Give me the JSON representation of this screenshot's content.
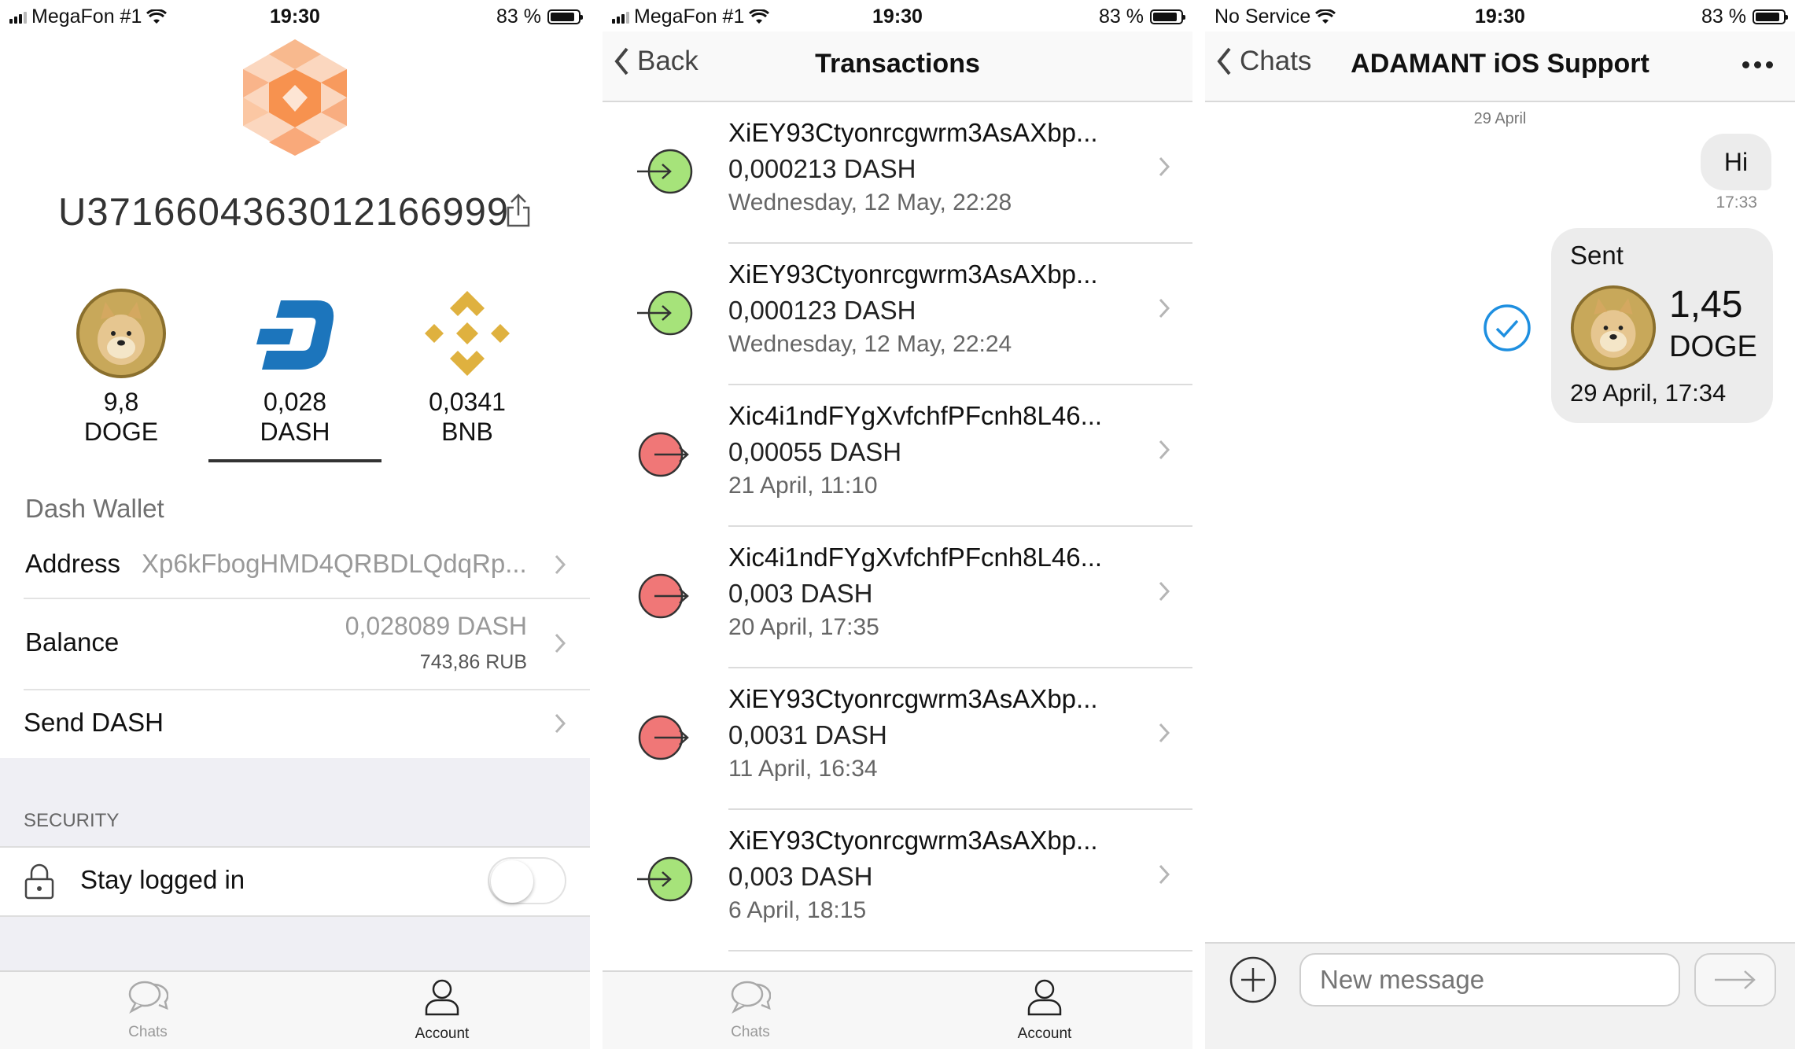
{
  "screens": [
    {
      "status": {
        "carrier": "MegaFon #1",
        "time": "19:30",
        "battery": "83 %"
      },
      "account_id": "U3716604363012166999",
      "coins": [
        {
          "value": "9,8",
          "symbol": "DOGE"
        },
        {
          "value": "0,028",
          "symbol": "DASH",
          "selected": true
        },
        {
          "value": "0,0341",
          "symbol": "BNB"
        }
      ],
      "wallet_title": "Dash Wallet",
      "address": {
        "label": "Address",
        "value": "Xp6kFbogHMD4QRBDLQdqRp..."
      },
      "balance": {
        "label": "Balance",
        "amount": "0,028089 DASH",
        "fiat": "743,86 RUB"
      },
      "send": {
        "label": "Send DASH"
      },
      "security": {
        "header": "SECURITY",
        "stay_logged_in": "Stay logged in",
        "toggle_on": false
      },
      "tabs": {
        "chats": "Chats",
        "account": "Account"
      }
    },
    {
      "status": {
        "carrier": "MegaFon #1",
        "time": "19:30",
        "battery": "83 %"
      },
      "back": "Back",
      "title": "Transactions",
      "transactions": [
        {
          "address": "XiEY93Ctyonrcgwrm3AsAXbp...",
          "amount": "0,000213 DASH",
          "date": "Wednesday, 12 May, 22:28",
          "direction": "incoming"
        },
        {
          "address": "XiEY93Ctyonrcgwrm3AsAXbp...",
          "amount": "0,000123 DASH",
          "date": "Wednesday, 12 May, 22:24",
          "direction": "incoming"
        },
        {
          "address": "Xic4i1ndFYgXvfchfPFcnh8L46...",
          "amount": "0,00055 DASH",
          "date": "21 April, 11:10",
          "direction": "outgoing"
        },
        {
          "address": "Xic4i1ndFYgXvfchfPFcnh8L46...",
          "amount": "0,003 DASH",
          "date": "20 April, 17:35",
          "direction": "outgoing"
        },
        {
          "address": "XiEY93Ctyonrcgwrm3AsAXbp...",
          "amount": "0,0031 DASH",
          "date": "11 April, 16:34",
          "direction": "outgoing"
        },
        {
          "address": "XiEY93Ctyonrcgwrm3AsAXbp...",
          "amount": "0,003 DASH",
          "date": "6 April, 18:15",
          "direction": "incoming"
        }
      ],
      "tabs": {
        "chats": "Chats",
        "account": "Account"
      }
    },
    {
      "status": {
        "carrier": "No Service",
        "time": "19:30",
        "battery": "83 %"
      },
      "back": "Chats",
      "title": "ADAMANT iOS Support",
      "day": "29 April",
      "hi": {
        "text": "Hi",
        "time": "17:33"
      },
      "transfer": {
        "label": "Sent",
        "amount": "1,45",
        "currency": "DOGE",
        "date": "29 April, 17:34"
      },
      "input_placeholder": "New message"
    }
  ],
  "colors": {
    "incoming": "#a6e37a",
    "outgoing": "#f07777",
    "dash": "#1c75bc",
    "bnb": "#dfb13f",
    "check": "#1e8fe0"
  },
  "icons": [
    "adamant-logo-icon",
    "share-icon",
    "doge-coin-icon",
    "dash-coin-icon",
    "bnb-coin-icon",
    "chevron-right-icon",
    "lock-icon",
    "chats-icon",
    "account-icon",
    "incoming-arrow-icon",
    "outgoing-arrow-icon",
    "back-chevron-icon",
    "more-dots-icon",
    "checkmark-icon",
    "plus-icon",
    "send-arrow-icon"
  ]
}
